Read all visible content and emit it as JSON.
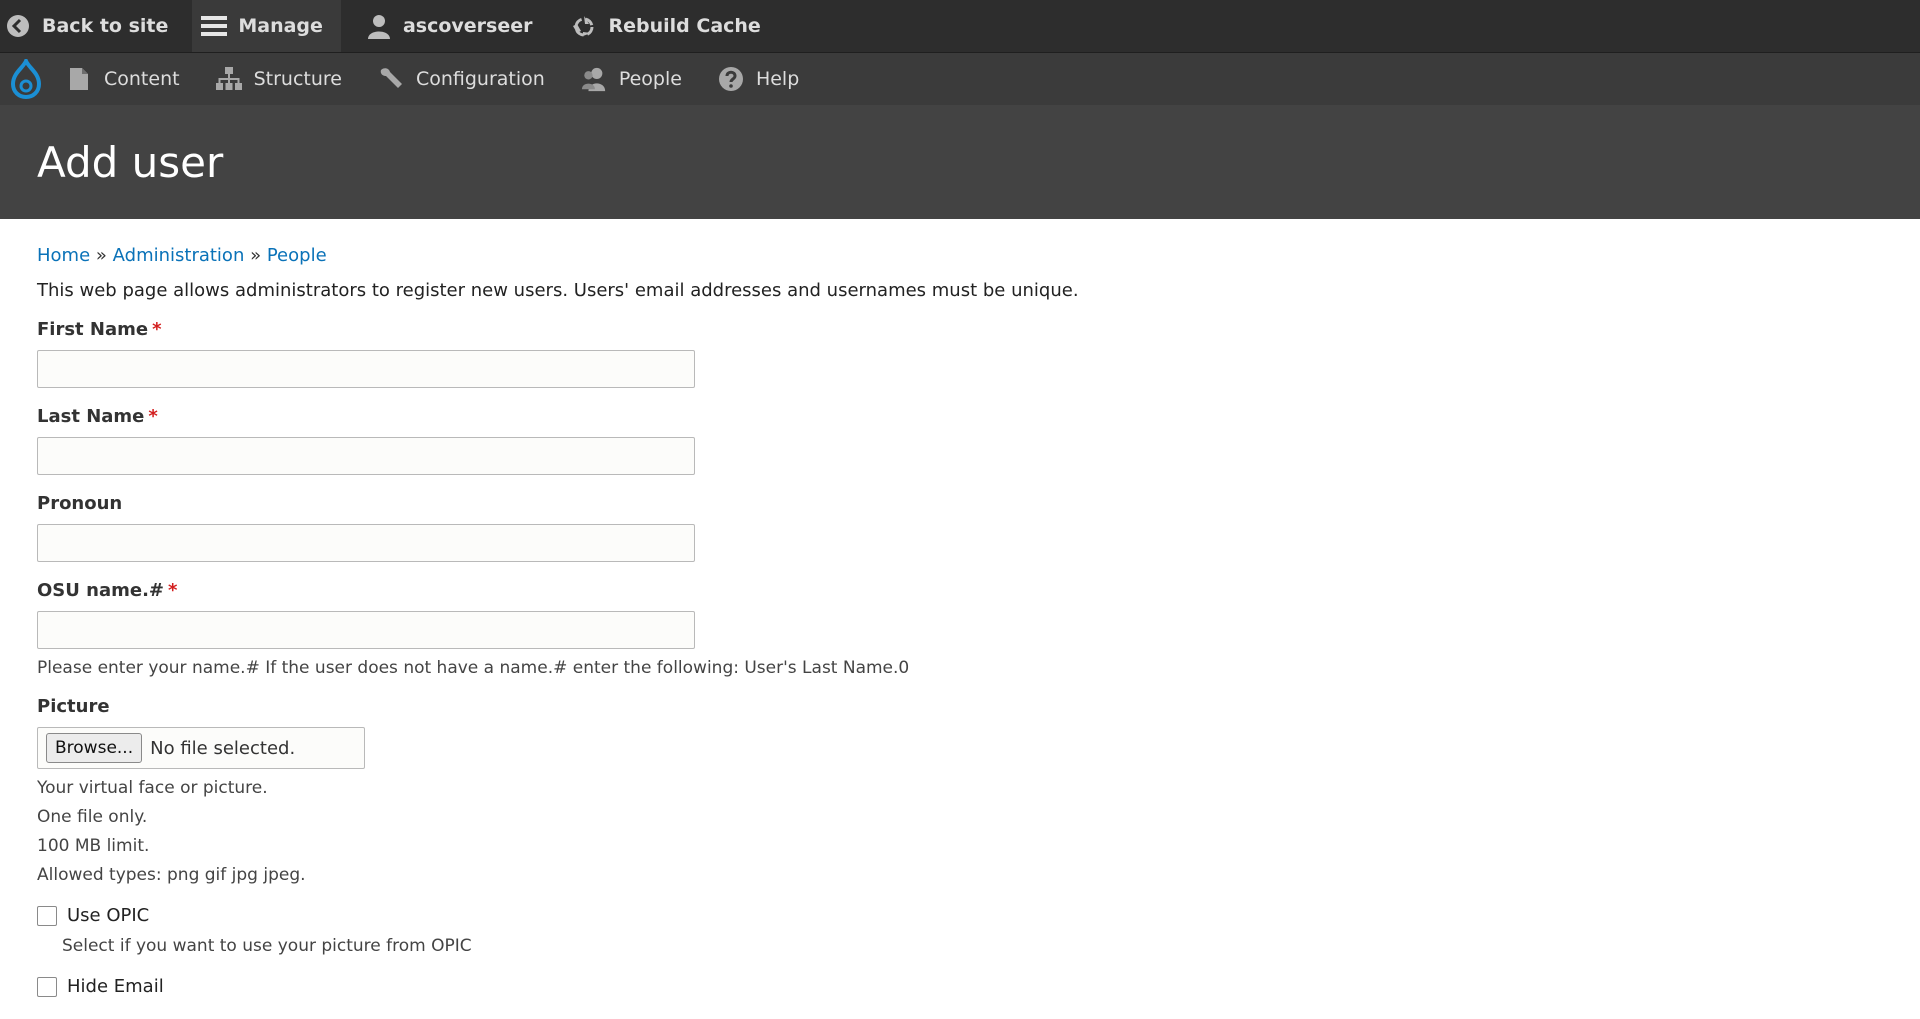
{
  "toolbar": {
    "back_label": "Back to site",
    "manage_label": "Manage",
    "user_label": "ascoverseer",
    "rebuild_label": "Rebuild Cache"
  },
  "tray": {
    "items": [
      {
        "label": "Content",
        "icon": "file-icon"
      },
      {
        "label": "Structure",
        "icon": "structure-icon"
      },
      {
        "label": "Configuration",
        "icon": "wrench-icon"
      },
      {
        "label": "People",
        "icon": "people-icon"
      },
      {
        "label": "Help",
        "icon": "help-icon"
      }
    ]
  },
  "header": {
    "title": "Add user"
  },
  "breadcrumb": {
    "home": "Home",
    "sep": "»",
    "admin": "Administration",
    "people": "People"
  },
  "intro": "This web page allows administrators to register new users. Users' email addresses and usernames must be unique.",
  "form": {
    "first_name": {
      "label": "First Name",
      "required_mark": "*",
      "value": ""
    },
    "last_name": {
      "label": "Last Name",
      "required_mark": "*",
      "value": ""
    },
    "pronoun": {
      "label": "Pronoun",
      "value": ""
    },
    "osu": {
      "label": "OSU name.#",
      "required_mark": "*",
      "value": "",
      "description": "Please enter your name.# If the user does not have a name.# enter the following: User's Last Name.0"
    },
    "picture": {
      "label": "Picture",
      "browse_label": "Browse...",
      "status": "No file selected.",
      "desc1": "Your virtual face or picture.",
      "desc2": "One file only.",
      "desc3": "100 MB limit.",
      "desc4": "Allowed types: png gif jpg jpeg."
    },
    "use_opic": {
      "label": "Use OPIC",
      "checked": false,
      "description": "Select if you want to use your picture from OPIC"
    },
    "hide_email": {
      "label": "Hide Email",
      "checked": false
    }
  },
  "colors": {
    "toolbar_bg": "#2d2d2d",
    "tray_bg": "#3b3b3b",
    "header_bg": "#434343",
    "link": "#0a72b8",
    "required": "#d31e1e",
    "drupal_blue": "#1b8fd4"
  }
}
